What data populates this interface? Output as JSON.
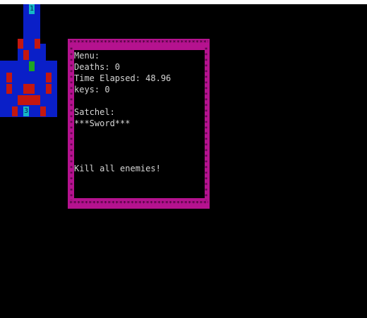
{
  "menu": {
    "title": "Menu:",
    "deaths": "Deaths: 0",
    "time": "Time Elapsed: 48.96",
    "keys": "keys: 0",
    "satchel_label": "Satchel:",
    "satchel_items": [
      "***Sword***"
    ],
    "objective": "Kill all enemies!"
  },
  "map": {
    "key_glyphs": [
      "1",
      "3"
    ]
  },
  "colors": {
    "background": "#000000",
    "floor": "#0a1fc8",
    "enemy": "#c4170f",
    "key": "#15b8c5",
    "player": "#1ea424",
    "menu_border": "#b5128f",
    "text": "#d6d6d6"
  }
}
